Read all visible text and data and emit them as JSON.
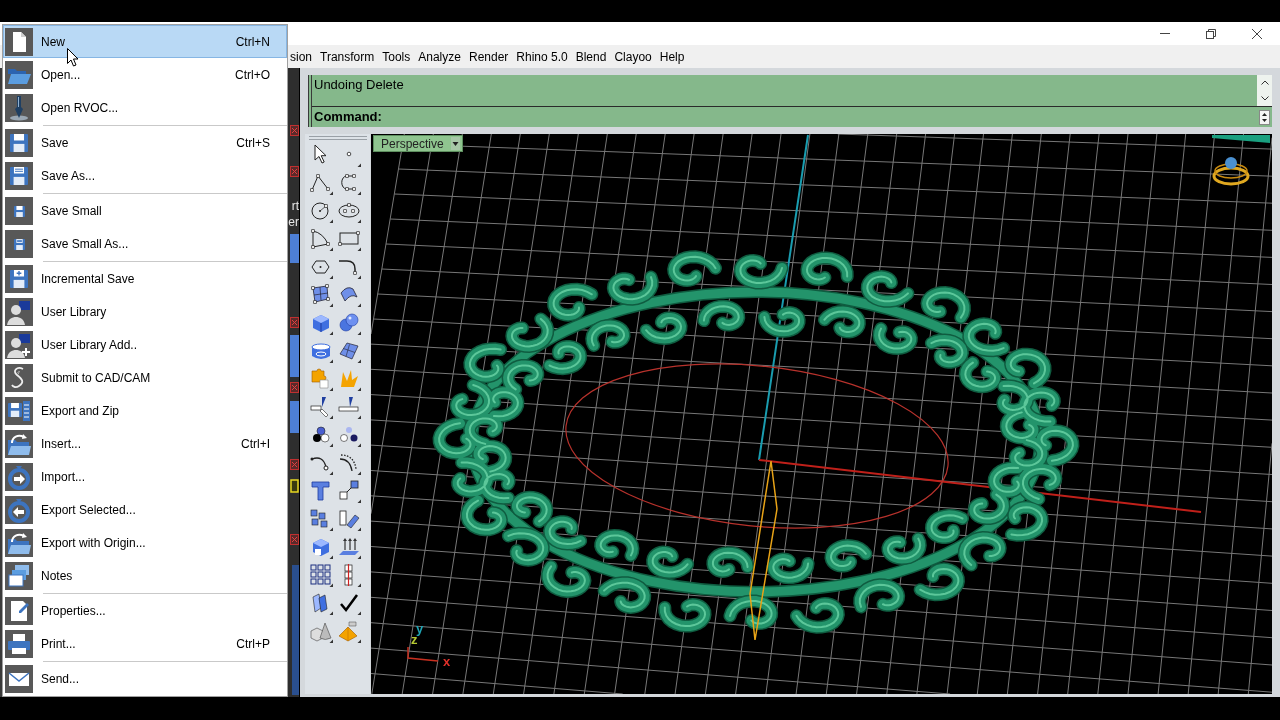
{
  "menu_bar": {
    "items": [
      "sion",
      "Transform",
      "Tools",
      "Analyze",
      "Render",
      "Rhino 5.0",
      "Blend",
      "Clayoo",
      "Help"
    ]
  },
  "file_menu": {
    "items": [
      {
        "kind": "item",
        "label": "New",
        "shortcut": "Ctrl+N",
        "selected": true
      },
      {
        "kind": "item",
        "label": "Open...",
        "shortcut": "Ctrl+O",
        "selected": false
      },
      {
        "kind": "item",
        "label": "Open RVOC...",
        "selected": false
      },
      {
        "kind": "separator"
      },
      {
        "kind": "item",
        "label": "Save",
        "shortcut": "Ctrl+S",
        "selected": false
      },
      {
        "kind": "item",
        "label": "Save As...",
        "selected": false
      },
      {
        "kind": "separator"
      },
      {
        "kind": "item",
        "label": "Save Small",
        "selected": false
      },
      {
        "kind": "item",
        "label": "Save Small As...",
        "selected": false
      },
      {
        "kind": "separator"
      },
      {
        "kind": "item",
        "label": "Incremental Save",
        "selected": false
      },
      {
        "kind": "item",
        "label": "User Library",
        "selected": false
      },
      {
        "kind": "item",
        "label": "User Library Add..",
        "selected": false
      },
      {
        "kind": "item",
        "label": "Submit to CAD/CAM",
        "selected": false
      },
      {
        "kind": "item",
        "label": "Export and Zip",
        "selected": false
      },
      {
        "kind": "item",
        "label": "Insert...",
        "shortcut": "Ctrl+I",
        "selected": false
      },
      {
        "kind": "item",
        "label": "Import...",
        "selected": false
      },
      {
        "kind": "item",
        "label": "Export Selected...",
        "selected": false
      },
      {
        "kind": "item",
        "label": "Export with Origin...",
        "selected": false
      },
      {
        "kind": "item",
        "label": "Notes",
        "selected": false
      },
      {
        "kind": "separator"
      },
      {
        "kind": "item",
        "label": "Properties...",
        "selected": false
      },
      {
        "kind": "item",
        "label": "Print...",
        "shortcut": "Ctrl+P",
        "selected": false
      },
      {
        "kind": "separator"
      },
      {
        "kind": "item",
        "label": "Send...",
        "selected": false
      }
    ]
  },
  "side_panel": {
    "fragments": [
      "rt",
      "er"
    ]
  },
  "command_area": {
    "history": "Undoing Delete",
    "prompt": "Command:"
  },
  "viewport": {
    "tab": {
      "label": "Perspective",
      "selected": true
    },
    "axis_labels": [
      {
        "label": "y",
        "color": "#1fa5b5"
      },
      {
        "label": "z",
        "color": "#b5c832"
      },
      {
        "label": "x",
        "color": "#e0302a"
      }
    ]
  }
}
